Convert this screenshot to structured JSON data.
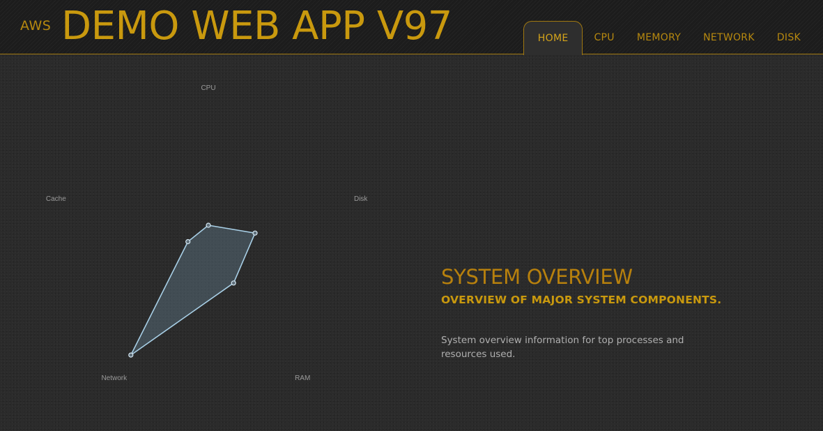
{
  "header": {
    "brand_small": "AWS",
    "brand_large": "DEMO WEB APP V97",
    "nav": [
      {
        "label": "HOME",
        "active": true
      },
      {
        "label": "CPU",
        "active": false
      },
      {
        "label": "MEMORY",
        "active": false
      },
      {
        "label": "NETWORK",
        "active": false
      },
      {
        "label": "DISK",
        "active": false
      }
    ]
  },
  "colors": {
    "accent": "#c9990e",
    "accent_dark": "#b7800d",
    "background": "#2b2b2b",
    "radar_stroke": "#a8cfe6",
    "radar_fill": "rgba(110,140,160,0.35)"
  },
  "chart_data": {
    "type": "radar",
    "axes": [
      "CPU",
      "Disk",
      "RAM",
      "Network",
      "Cache"
    ],
    "series": [
      {
        "values": [
          0.15,
          0.32,
          0.28,
          0.86,
          0.14
        ]
      }
    ],
    "range": [
      0,
      1
    ]
  },
  "overview": {
    "title": "SYSTEM OVERVIEW",
    "subtitle": "OVERVIEW OF MAJOR SYSTEM COMPONENTS.",
    "description": "System overview information for top processes and resources used."
  }
}
